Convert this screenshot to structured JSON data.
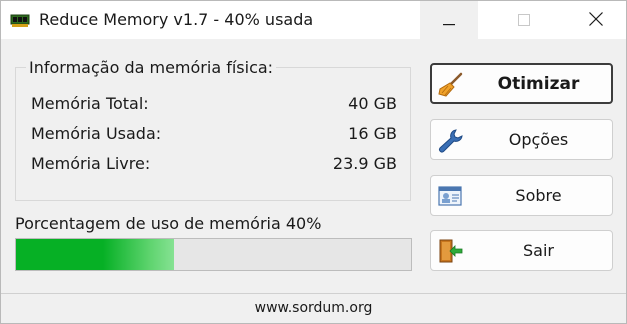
{
  "window": {
    "title": "Reduce Memory v1.7 - 40% usada",
    "icon": "memory-chip-icon",
    "controls": [
      "minimize-icon",
      "maximize-icon",
      "close-icon"
    ]
  },
  "memory_info": {
    "title": "Informação da memória física:",
    "rows": [
      {
        "label": "Memória Total:",
        "value": "40 GB"
      },
      {
        "label": "Memória Usada:",
        "value": "16 GB"
      },
      {
        "label": "Memória Livre:",
        "value": "23.9 GB"
      }
    ]
  },
  "usage": {
    "label": "Porcentagem de uso de memória 40%",
    "percent": 40,
    "bar_color": "#06b025"
  },
  "buttons": [
    {
      "label": "Otimizar",
      "icon": "broom-icon"
    },
    {
      "label": "Opções",
      "icon": "wrench-icon"
    },
    {
      "label": "Sobre",
      "icon": "id-card-icon"
    },
    {
      "label": "Sair",
      "icon": "exit-door-icon"
    }
  ],
  "footer": {
    "link_text": "www.sordum.org"
  }
}
